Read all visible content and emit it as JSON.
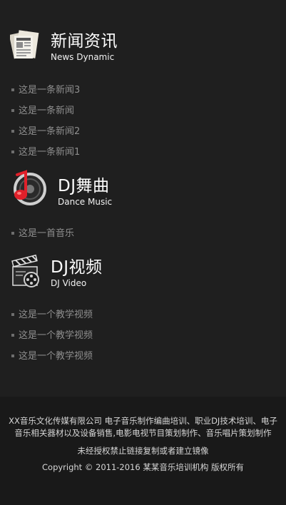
{
  "sections": [
    {
      "title": "新闻资讯",
      "subtitle": "News Dynamic",
      "icon": "newspaper-icon",
      "items": [
        "这是一条新闻3",
        "这是一条新闻",
        "这是一条新闻2",
        "这是一条新闻1"
      ]
    },
    {
      "title": "DJ舞曲",
      "subtitle": "Dance Music",
      "icon": "music-note-icon",
      "items": [
        "这是一首音乐"
      ]
    },
    {
      "title": "DJ视频",
      "subtitle": "DJ Video",
      "icon": "film-clapper-icon",
      "items": [
        "这是一个教学视频",
        "这是一个教学视频",
        "这是一个教学视频"
      ]
    }
  ],
  "footer": {
    "company": "XX音乐文化传媒有限公司 电子音乐制作编曲培训、职业DJ技术培训、电子音乐相关器材以及设备销售,电影电视节目策划制作、音乐唱片策划制作",
    "notice": "未经授权禁止链接复制或者建立镜像",
    "copyright": "Copyright © 2011-2016 某某音乐培训机构 版权所有"
  },
  "colors": {
    "background": "#1f1f1f",
    "footer_background": "#191919",
    "title": "#ffffff",
    "list_text": "#8e8e8e",
    "music_note": "#e0202a"
  }
}
